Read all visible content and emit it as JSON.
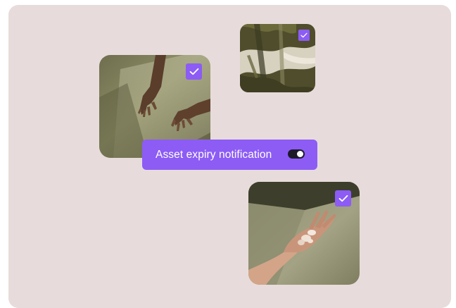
{
  "notification": {
    "label": "Asset expiry notification",
    "toggle_state": "on"
  },
  "images": [
    {
      "name": "hands-photo",
      "subject": "two hands resting on a surface",
      "selected": true
    },
    {
      "name": "fabric-photo",
      "subject": "striped olive and cream fabric",
      "selected": true
    },
    {
      "name": "petals-photo",
      "subject": "open hand holding petals",
      "selected": true
    }
  ],
  "colors": {
    "background": "#e7dcdb",
    "accent": "#8c5cf5",
    "toggle_track": "#1e1a2a",
    "toggle_knob": "#ffffff"
  },
  "icons": {
    "selection": "checkmark-icon"
  }
}
